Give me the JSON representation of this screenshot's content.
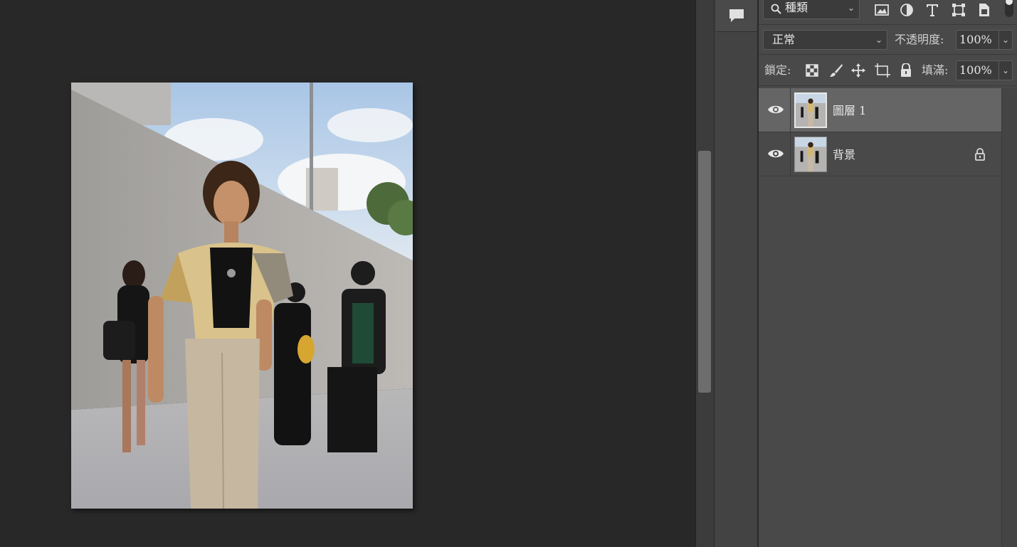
{
  "layers_panel": {
    "filter": {
      "label": "種類",
      "icon": "search-icon"
    },
    "filter_icons": [
      "image-filter-icon",
      "adjustment-filter-icon",
      "type-filter-icon",
      "shape-filter-icon",
      "smart-object-filter-icon"
    ],
    "blend_mode": "正常",
    "opacity_label": "不透明度:",
    "opacity_value": "100%",
    "lock_label": "鎖定:",
    "lock_icons": [
      "lock-transparent-icon",
      "lock-paint-icon",
      "lock-position-icon",
      "lock-artboard-icon",
      "lock-all-icon"
    ],
    "fill_label": "填滿:",
    "fill_value": "100%",
    "layers": [
      {
        "name": "圖層 1",
        "visible": true,
        "selected": true,
        "locked": false
      },
      {
        "name": "背景",
        "visible": true,
        "selected": false,
        "locked": true
      }
    ]
  },
  "colors": {
    "canvas_bg": "#282828",
    "panel_bg": "#494949",
    "selected_layer": "#656565"
  }
}
